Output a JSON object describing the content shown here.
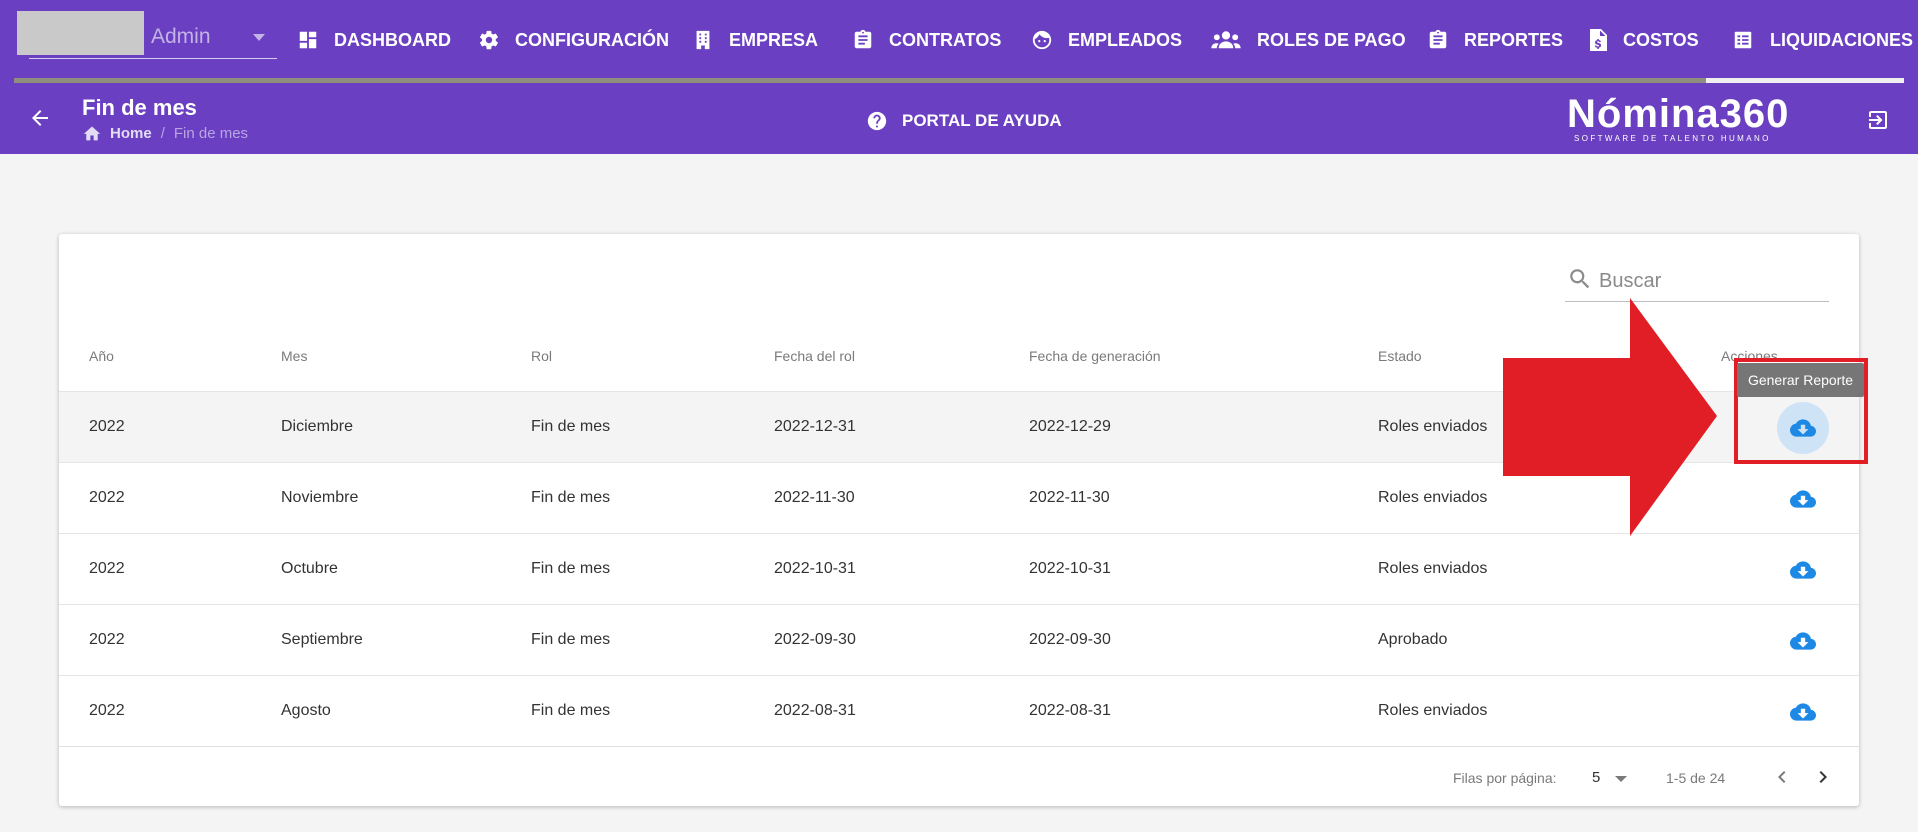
{
  "topnav": {
    "admin_label": "Admin",
    "items": [
      {
        "label": "DASHBOARD",
        "icon": "dashboard-icon"
      },
      {
        "label": "CONFIGURACIÓN",
        "icon": "gear-icon"
      },
      {
        "label": "EMPRESA",
        "icon": "building-icon"
      },
      {
        "label": "CONTRATOS",
        "icon": "clipboard-icon"
      },
      {
        "label": "EMPLEADOS",
        "icon": "face-icon"
      },
      {
        "label": "ROLES DE PAGO",
        "icon": "people-icon"
      },
      {
        "label": "REPORTES",
        "icon": "clipboard-icon"
      },
      {
        "label": "COSTOS",
        "icon": "invoice-icon"
      },
      {
        "label": "LIQUIDACIONES",
        "icon": "list-icon"
      }
    ],
    "active_item": "LIQUIDACIONES"
  },
  "subheader": {
    "title": "Fin de mes",
    "breadcrumb_home": "Home",
    "breadcrumb_sep": "/",
    "breadcrumb_current": "Fin de mes",
    "help_label": "PORTAL DE AYUDA",
    "brand": "Nómina360",
    "brand_tagline": "SOFTWARE DE TALENTO HUMANO"
  },
  "search": {
    "placeholder": "Buscar"
  },
  "table": {
    "headers": [
      "Año",
      "Mes",
      "Rol",
      "Fecha del rol",
      "Fecha de generación",
      "Estado",
      "Acciones"
    ],
    "rows": [
      [
        "2022",
        "Diciembre",
        "Fin de mes",
        "2022-12-31",
        "2022-12-29",
        "Roles enviados"
      ],
      [
        "2022",
        "Noviembre",
        "Fin de mes",
        "2022-11-30",
        "2022-11-30",
        "Roles enviados"
      ],
      [
        "2022",
        "Octubre",
        "Fin de mes",
        "2022-10-31",
        "2022-10-31",
        "Roles enviados"
      ],
      [
        "2022",
        "Septiembre",
        "Fin de mes",
        "2022-09-30",
        "2022-09-30",
        "Aprobado"
      ],
      [
        "2022",
        "Agosto",
        "Fin de mes",
        "2022-08-31",
        "2022-08-31",
        "Roles enviados"
      ]
    ],
    "action_icon": "cloud-download-icon"
  },
  "pagination": {
    "rows_per_page_label": "Filas por página:",
    "rows_per_page": "5",
    "range": "1-5 de 24"
  },
  "tooltip": "Generar Reporte",
  "colors": {
    "nav_bg": "#6a3fc1",
    "download_icon": "#1e88e5",
    "annotation": "#e11d25"
  }
}
